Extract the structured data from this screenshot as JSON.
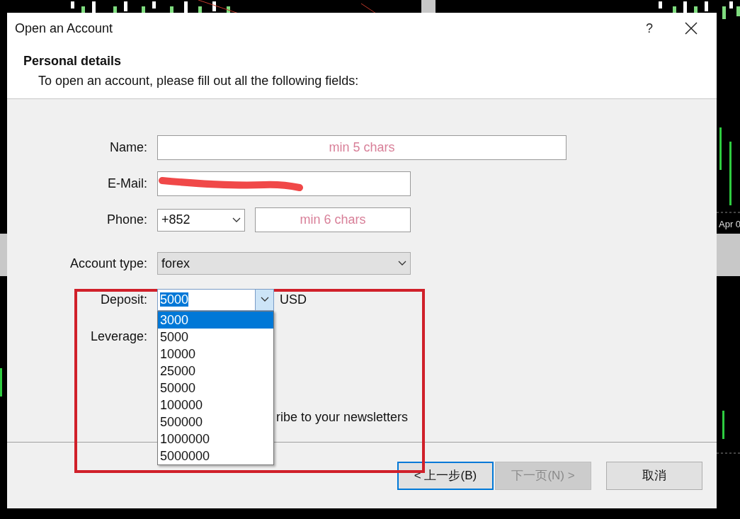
{
  "window": {
    "title": "Open an Account",
    "help": "?"
  },
  "header": {
    "title": "Personal details",
    "subtitle": "To open an account, please fill out all the following fields:"
  },
  "form": {
    "name": {
      "label": "Name:",
      "placeholder": "min 5 chars"
    },
    "email": {
      "label": "E-Mail:",
      "redacted": true
    },
    "phone": {
      "label": "Phone:",
      "code": "+852",
      "placeholder": "min 6 chars"
    },
    "account_type": {
      "label": "Account type:",
      "value": "forex"
    },
    "deposit": {
      "label": "Deposit:",
      "value": "5000",
      "currency": "USD",
      "expanded": true,
      "options": [
        {
          "label": "3000",
          "highlighted": true
        },
        {
          "label": "5000",
          "highlighted": false
        },
        {
          "label": "10000",
          "highlighted": false
        },
        {
          "label": "25000",
          "highlighted": false
        },
        {
          "label": "50000",
          "highlighted": false
        },
        {
          "label": "100000",
          "highlighted": false
        },
        {
          "label": "500000",
          "highlighted": false
        },
        {
          "label": "1000000",
          "highlighted": false
        },
        {
          "label": "5000000",
          "highlighted": false
        }
      ]
    },
    "leverage": {
      "label": "Leverage:"
    },
    "newsletter": {
      "label": "ribe to your newsletters"
    }
  },
  "buttons": [
    {
      "label": "< 上一步(B)",
      "disabled": false,
      "focused": true
    },
    {
      "label": "下一页(N) >",
      "disabled": true,
      "focused": false
    },
    {
      "label": "取消",
      "disabled": false,
      "focused": false
    }
  ],
  "background": {
    "axis_label": "Apr 0"
  },
  "annotation": {
    "highlight": true
  }
}
